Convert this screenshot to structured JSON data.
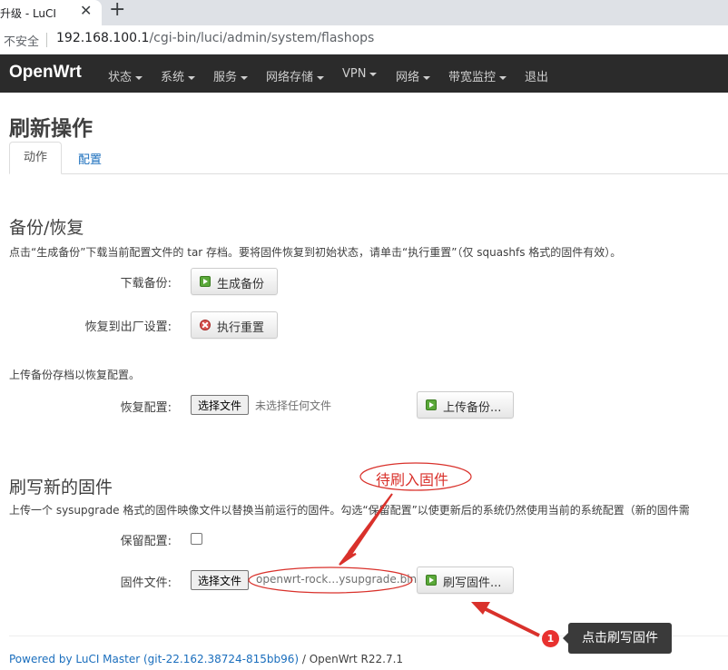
{
  "browser": {
    "tab_title": "升级 - LuCI",
    "close_glyph": "✕",
    "new_tab_glyph": "+",
    "security_label": "不安全",
    "url_host": "192.168.100.1",
    "url_path": "/cgi-bin/luci/admin/system/flashops"
  },
  "navbar": {
    "brand": "OpenWrt",
    "items": [
      "状态",
      "系统",
      "服务",
      "网络存储",
      "VPN",
      "网络",
      "带宽监控"
    ],
    "logout": "退出"
  },
  "page": {
    "title": "刷新操作",
    "tabs": [
      "动作",
      "配置"
    ]
  },
  "backup": {
    "heading": "备份/恢复",
    "description": "点击“生成备份”下载当前配置文件的 tar 存档。要将固件恢复到初始状态，请单击“执行重置”（仅 squashfs 格式的固件有效）。",
    "download_label": "下载备份:",
    "download_button": "生成备份",
    "reset_label": "恢复到出厂设置:",
    "reset_button": "执行重置",
    "upload_description": "上传备份存档以恢复配置。",
    "restore_label": "恢复配置:",
    "choose_file": "选择文件",
    "no_file": "未选择任何文件",
    "upload_button": "上传备份..."
  },
  "flash": {
    "heading": "刷写新的固件",
    "description": "上传一个 sysupgrade 格式的固件映像文件以替换当前运行的固件。勾选“保留配置”以使更新后的系统仍然使用当前的系统配置（新的固件需",
    "keep_label": "保留配置:",
    "keep_checked": false,
    "image_label": "固件文件:",
    "choose_file": "选择文件",
    "file_name": "openwrt-rock…ysupgrade.bin",
    "flash_button": "刷写固件..."
  },
  "footer": {
    "link": "Powered by LuCI Master (git-22.162.38724-815bb96)",
    "text": " / OpenWrt R22.7.1"
  },
  "annotations": {
    "label_top": "待刷入固件",
    "badge_number": "1",
    "tooltip": "点击刷写固件",
    "color": "#d9312b"
  }
}
